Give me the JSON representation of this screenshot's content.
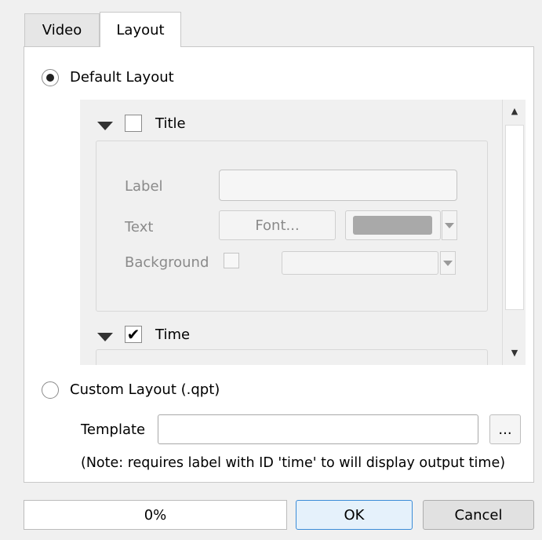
{
  "tabs": [
    {
      "label": "Video",
      "active": false
    },
    {
      "label": "Layout",
      "active": true
    }
  ],
  "default_layout": {
    "label": "Default Layout",
    "selected": true
  },
  "sections": {
    "title": {
      "label": "Title",
      "checked": false,
      "expanded": true
    },
    "time": {
      "label": "Time",
      "checked": true,
      "expanded": true
    }
  },
  "title_group": {
    "label_row": {
      "label": "Label",
      "value": ""
    },
    "text_row": {
      "label": "Text",
      "font_button": "Font...",
      "color": "#a9a9a9"
    },
    "background_row": {
      "label": "Background",
      "checked": false,
      "color_value": ""
    }
  },
  "custom_layout": {
    "label": "Custom Layout (.qpt)",
    "selected": false,
    "template_label": "Template",
    "template_value": "",
    "browse_label": "...",
    "note": "(Note: requires label with ID 'time' to will display output time)"
  },
  "footer": {
    "progress_text": "0%",
    "progress_value": 0,
    "ok_label": "OK",
    "cancel_label": "Cancel"
  },
  "icons": {
    "expand": "triangle-down-icon",
    "check": "✔",
    "scroll_up": "▲",
    "scroll_down": "▼"
  }
}
